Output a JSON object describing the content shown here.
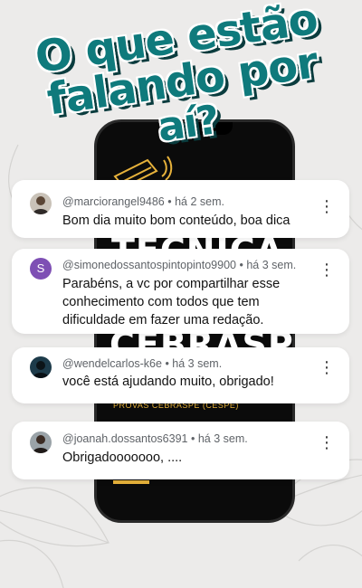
{
  "headline": {
    "line1": "O que estão",
    "line2": "falando por",
    "line3": "aí?"
  },
  "phone_screen": {
    "line1": "TÉCNICA DE",
    "line2": "CEBRASPE",
    "sub": "PROVAS CEBRASPE (CESPE)"
  },
  "colors": {
    "headline": "#0f7a7c",
    "headline_shadow": "#0a3c3e",
    "accent_gold": "#e7b23b",
    "avatar_s": "#7e4fb4"
  },
  "comments": [
    {
      "author": "@marciorangel9486",
      "time": "há 2 sem.",
      "text": "Bom dia muito bom conteúdo, boa dica",
      "avatar": "photo"
    },
    {
      "author": "@simonedossantospintopinto9900",
      "time": "há 3 sem.",
      "text": "Parabéns, a vc por compartilhar esse conhecimento com todos que tem dificuldade em fazer uma redação.",
      "avatar_letter": "S"
    },
    {
      "author": "@wendelcarlos-k6e",
      "time": "há 3 sem.",
      "text": "você está ajudando muito, obrigado!",
      "avatar": "photo"
    },
    {
      "author": "@joanah.dossantos6391",
      "time": "há 3 sem.",
      "text": "Obrigadooooooo, ....",
      "avatar": "photo"
    }
  ],
  "meta_separator": " • ",
  "more_icon": "more-vert-icon"
}
